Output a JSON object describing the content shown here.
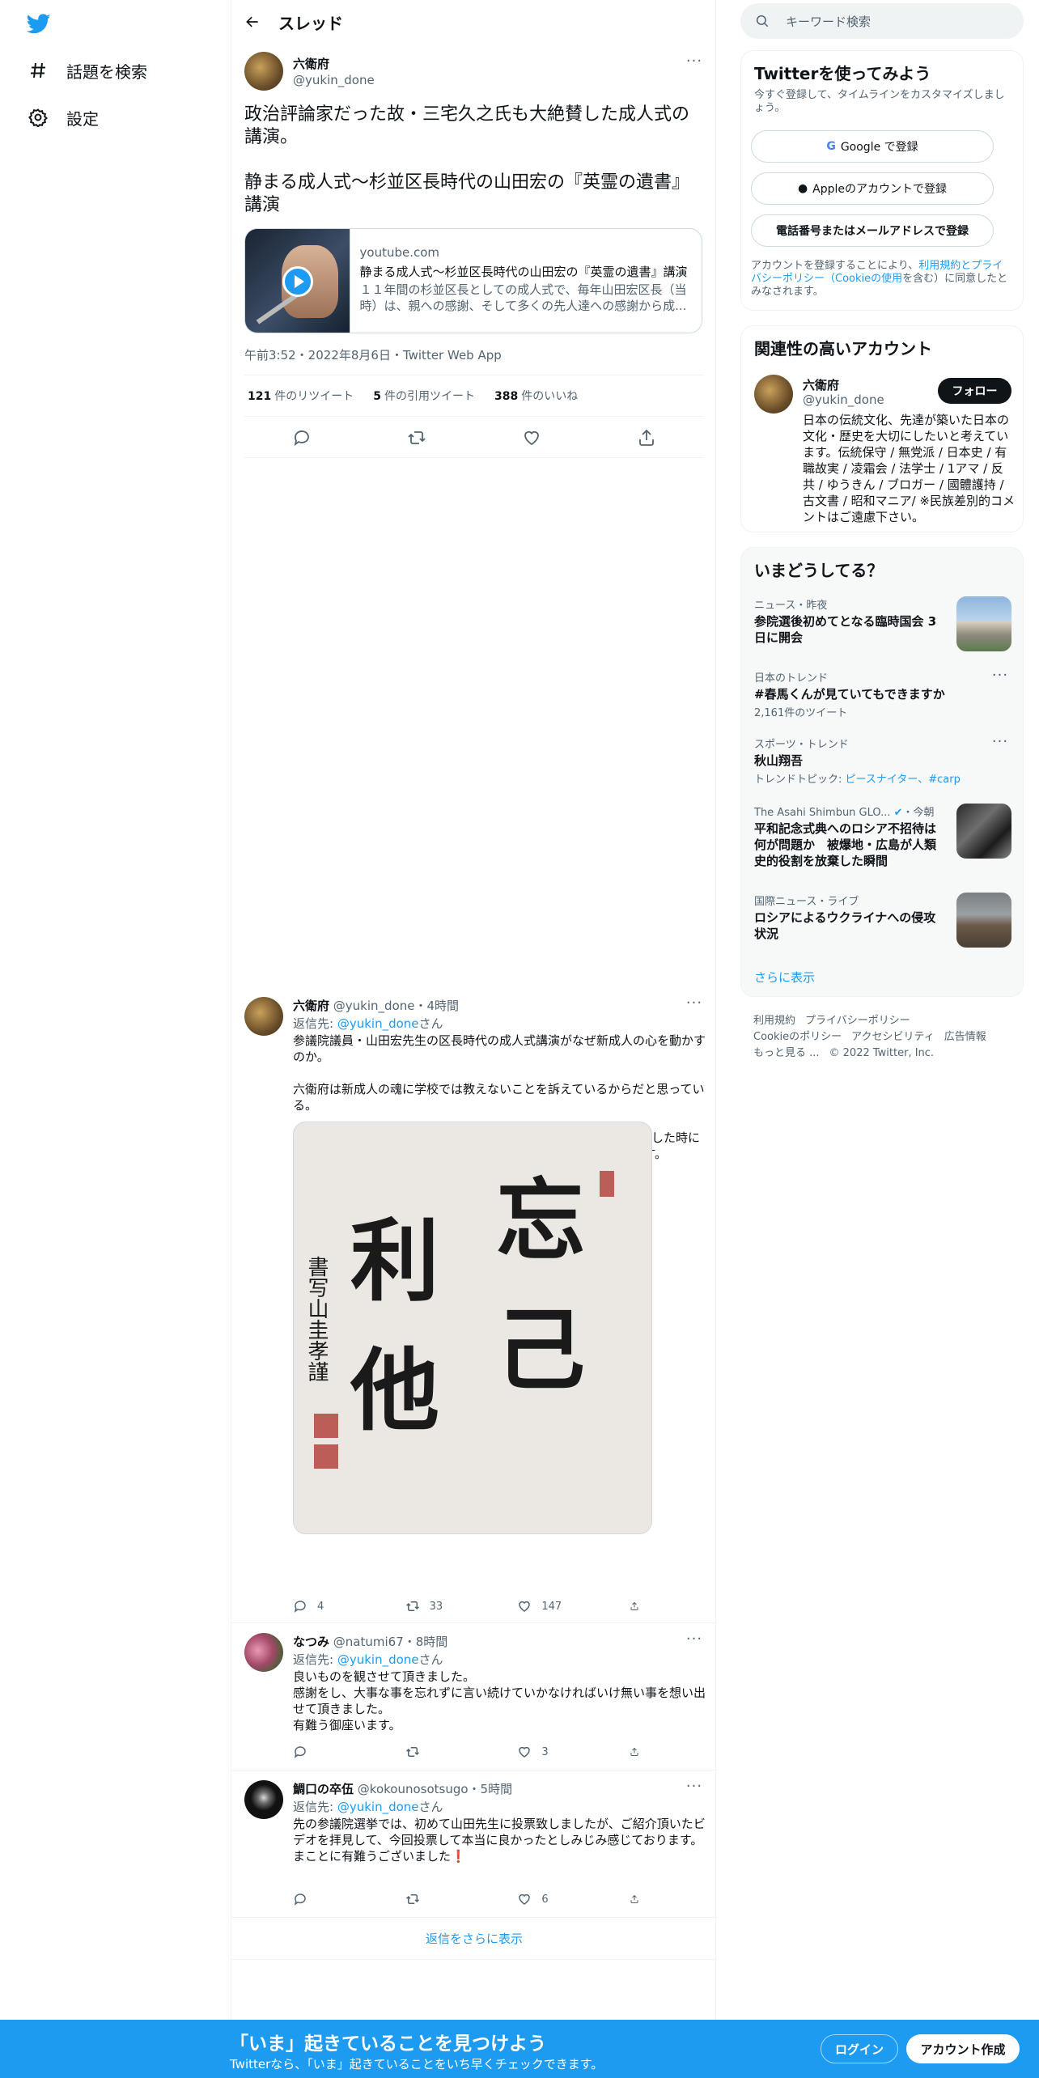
{
  "nav": {
    "items": [
      {
        "label": "話題を検索",
        "icon": "hashtag-icon"
      },
      {
        "label": "設定",
        "icon": "gear-icon"
      }
    ]
  },
  "header": {
    "title": "スレッド"
  },
  "main_tweet": {
    "name": "六衛府",
    "handle": "@yukin_done",
    "text": "政治評論家だった故・三宅久之氏も大絶賛した成人式の講演。\n\n静まる成人式～杉並区長時代の山田宏の『英霊の遺書』講演",
    "card": {
      "domain": "youtube.com",
      "title": "静まる成人式～杉並区長時代の山田宏の『英霊の遺書』講演",
      "description": "１１年間の杉並区長としての成人式で、毎年山田宏区長（当時）は、親への感謝、そして多くの先人達への感謝から成..."
    },
    "timestamp": "午前3:52・2022年8月6日・Twitter Web App",
    "stats": [
      {
        "count": "121",
        "label": "件のリツイート"
      },
      {
        "count": "5",
        "label": "件の引用ツイート"
      },
      {
        "count": "388",
        "label": "件のいいね"
      }
    ]
  },
  "replies": [
    {
      "name": "六衛府",
      "handle": "@yukin_done",
      "time": "・4時間",
      "reply_prefix": "返信先: ",
      "reply_to": "@yukin_done",
      "reply_suffix": "さん",
      "text": "参議院議員・山田宏先生の区長時代の成人式講演がなぜ新成人の心を動かすのか。\n\n六衛府は新成人の魂に学校では教えないことを訴えているからだと思っている。\n\n俺が俺がの教育を受けて育ってきたのだが7年前にこの講演を拝見した時に忘己利他の精神を知ることができたのです。この講演、値千金です。",
      "image_text": "忘己利他",
      "image_signature": "書写山圭孝謹",
      "replies": "4",
      "retweets": "33",
      "likes": "147"
    },
    {
      "name": "なつみ",
      "handle": "@natumi67",
      "time": "・8時間",
      "reply_prefix": "返信先: ",
      "reply_to": "@yukin_done",
      "reply_suffix": "さん",
      "text": "良いものを観させて頂きました。\n感謝をし、大事な事を忘れずに言い続けていかなければいけ無い事を想い出せて頂きました。\n有難う御座います。",
      "replies": "",
      "retweets": "",
      "likes": "3"
    },
    {
      "name": "鯛口の卒伍",
      "handle": "@kokounosotsugo",
      "time": "・5時間",
      "reply_prefix": "返信先: ",
      "reply_to": "@yukin_done",
      "reply_suffix": "さん",
      "text": "先の参議院選挙では、初めて山田先生に投票致しましたが、ご紹介頂いたビデオを拝見して、今回投票して本当に良かったとしみじみ感じております。\nまことに有難うございました❗",
      "replies": "",
      "retweets": "",
      "likes": "6"
    }
  ],
  "more_replies": "返信をさらに表示",
  "search": {
    "placeholder": "キーワード検索"
  },
  "signup": {
    "title": "Twitterを使ってみよう",
    "subtitle": "今すぐ登録して、タイムラインをカスタマイズしましょう。",
    "google": "Google で登録",
    "apple": "Appleのアカウントで登録",
    "phone": "電話番号またはメールアドレスで登録",
    "terms_prefix": "アカウントを登録することにより、",
    "terms_link": "利用規約とプライバシーポリシー（Cookieの使用",
    "terms_suffix": "を含む）に同意したとみなされます。"
  },
  "related": {
    "title": "関連性の高いアカウント",
    "name": "六衛府",
    "handle": "@yukin_done",
    "follow": "フォロー",
    "bio": "日本の伝統文化、先達が築いた日本の文化・歴史を大切にしたいと考えています。伝統保守 / 無党派 / 日本史 / 有職故実 / 凌霜会 / 法学士 / 1アマ / 反共 / ゆうきん / ブロガー / 國體護持 / 古文書 / 昭和マニア/ ※民族差別的コメントはご遠慮下さい。"
  },
  "trends": {
    "title": "いまどうしてる？",
    "items": [
      {
        "meta": "ニュース・昨夜",
        "title": "参院選後初めてとなる臨時国会 3日に開会",
        "sub": "",
        "has_image": true
      },
      {
        "meta": "日本のトレンド",
        "title": "#春馬くんが見ていてもできますか",
        "sub": "2,161件のツイート",
        "has_image": false
      },
      {
        "meta": "スポーツ・トレンド",
        "title": "秋山翔吾",
        "sub_prefix": "トレンドトピック: ",
        "sub_links": "ピースナイター、#carp",
        "has_image": false
      },
      {
        "meta": "The Asahi Shimbun GLO...",
        "meta_time": "・今朝",
        "title": "平和記念式典へのロシア不招待は何が問題か　被爆地・広島が人類史的役割を放棄した瞬間",
        "sub": "",
        "has_image": true
      },
      {
        "meta": "国際ニュース・ライブ",
        "title": "ロシアによるウクライナへの侵攻状況",
        "sub": "",
        "has_image": true
      }
    ],
    "show_more": "さらに表示"
  },
  "footer": {
    "links": [
      "利用規約",
      "プライバシーポリシー",
      "Cookieのポリシー",
      "アクセシビリティ",
      "広告情報",
      "もっと見る ...",
      "© 2022 Twitter, Inc."
    ]
  },
  "bottom_bar": {
    "title": "「いま」起きていることを見つけよう",
    "subtitle": "Twitterなら、「いま」起きていることをいち早くチェックできます。",
    "login": "ログイン",
    "signup": "アカウント作成"
  },
  "colors": {
    "accent": "#1d9bf0",
    "text": "#0f1419",
    "muted": "#536471",
    "border": "#eff3f4"
  }
}
